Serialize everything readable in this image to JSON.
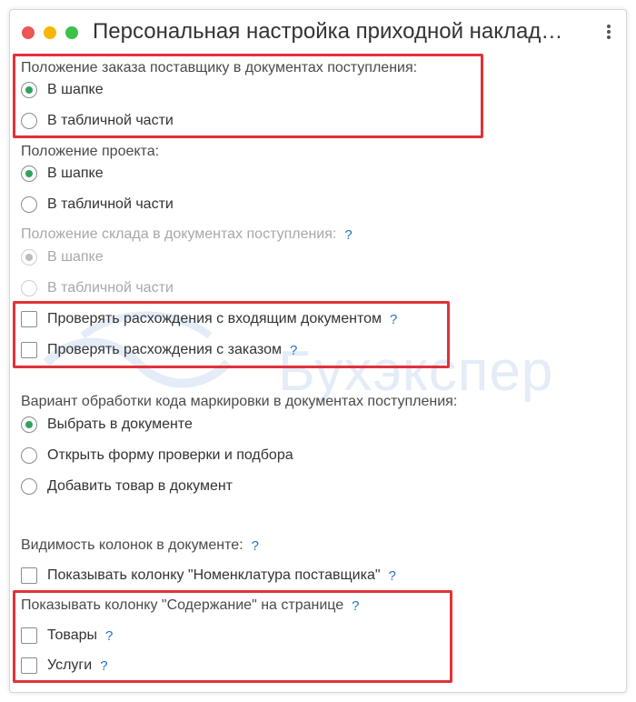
{
  "window": {
    "title": "Персональная настройка приходной наклад…"
  },
  "watermark": {
    "text": "Бухэкспер"
  },
  "order_position": {
    "label": "Положение заказа поставщику в документах поступления:",
    "options": [
      {
        "label": "В шапке",
        "checked": true
      },
      {
        "label": "В табличной части",
        "checked": false
      }
    ]
  },
  "project_position": {
    "label": "Положение проекта:",
    "options": [
      {
        "label": "В шапке",
        "checked": true
      },
      {
        "label": "В табличной части",
        "checked": false
      }
    ]
  },
  "warehouse_position": {
    "label": "Положение склада в документах поступления:",
    "help": "?",
    "options": [
      {
        "label": "В шапке",
        "checked": true
      },
      {
        "label": "В табличной части",
        "checked": false
      }
    ]
  },
  "checks": {
    "incoming_doc": {
      "label": "Проверять расхождения с входящим документом",
      "help": "?"
    },
    "order": {
      "label": "Проверять расхождения с заказом",
      "help": "?"
    }
  },
  "marking": {
    "label": "Вариант обработки кода маркировки в документах поступления:",
    "options": [
      {
        "label": "Выбрать в документе",
        "checked": true
      },
      {
        "label": "Открыть форму проверки и подбора",
        "checked": false
      },
      {
        "label": "Добавить товар в документ",
        "checked": false
      }
    ]
  },
  "columns": {
    "label": "Видимость колонок в документе:",
    "help": "?",
    "supplier_nomenclature": {
      "label": "Показывать колонку \"Номенклатура поставщика\"",
      "help": "?"
    },
    "content": {
      "label": "Показывать колонку \"Содержание\" на странице",
      "help": "?",
      "goods": {
        "label": "Товары",
        "help": "?"
      },
      "services": {
        "label": "Услуги",
        "help": "?"
      }
    }
  },
  "colors": {
    "accent_radio": "#2fa35a",
    "help_link": "#2173c4",
    "highlight": "#e0313a"
  }
}
